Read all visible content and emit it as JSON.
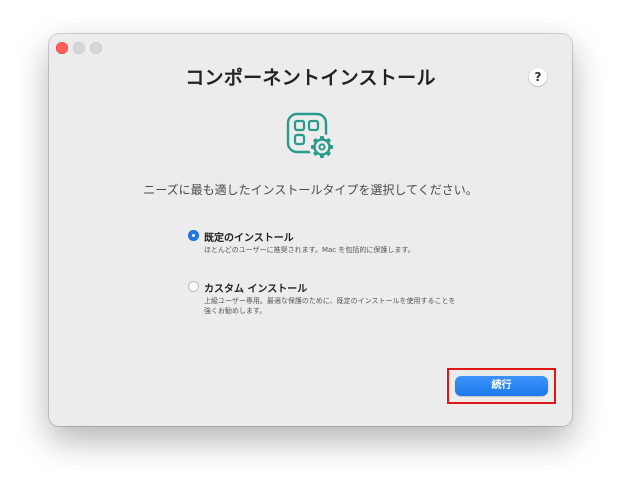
{
  "window": {
    "title": "コンポーネントインストール",
    "help_label": "?",
    "controls": [
      "close",
      "minimize",
      "zoom"
    ]
  },
  "icon": {
    "name": "component-settings-icon",
    "color": "#2a9a8c"
  },
  "subtitle": "ニーズに最も適したインストールタイプを選択してください。",
  "options": [
    {
      "label": "既定のインストール",
      "description": "ほとんどのユーザーに推奨されます。Mac を包括的に保護します。",
      "selected": true
    },
    {
      "label": "カスタム インストール",
      "description": "上級ユーザー専用。最適な保護のために、既定のインストールを使用することを強くお勧めします。",
      "selected": false
    }
  ],
  "continue_button": {
    "label": "続行",
    "color": "#1f7ae8"
  },
  "highlight_color": "#e01515"
}
